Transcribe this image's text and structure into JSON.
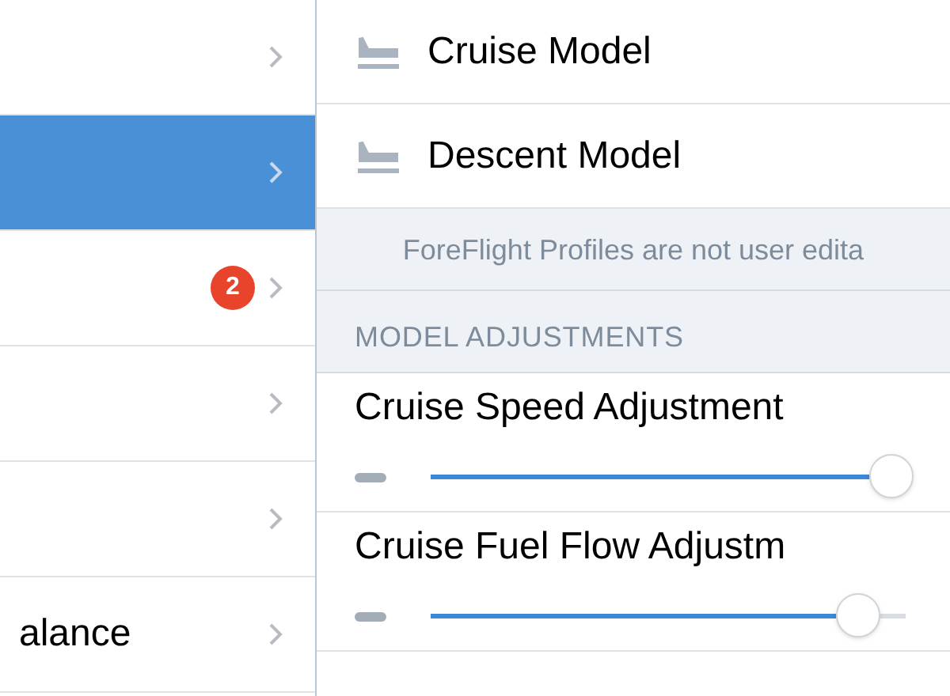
{
  "sidebar": {
    "items": [
      {
        "selected": false
      },
      {
        "selected": true
      },
      {
        "selected": false,
        "badge": "2"
      },
      {
        "selected": false
      },
      {
        "selected": false
      },
      {
        "label": "alance",
        "selected": false
      }
    ]
  },
  "panel": {
    "rows": [
      {
        "kind": "model",
        "label": "Cruise Model"
      },
      {
        "kind": "model",
        "label": "Descent Model"
      },
      {
        "kind": "note",
        "label": "ForeFlight Profiles are not user edita"
      },
      {
        "kind": "header",
        "label": "MODEL ADJUSTMENTS"
      },
      {
        "kind": "slider",
        "label": "Cruise Speed Adjustment",
        "level": 0.97
      },
      {
        "kind": "slider",
        "label": "Cruise Fuel Flow Adjustm",
        "level": 0.9
      }
    ]
  }
}
